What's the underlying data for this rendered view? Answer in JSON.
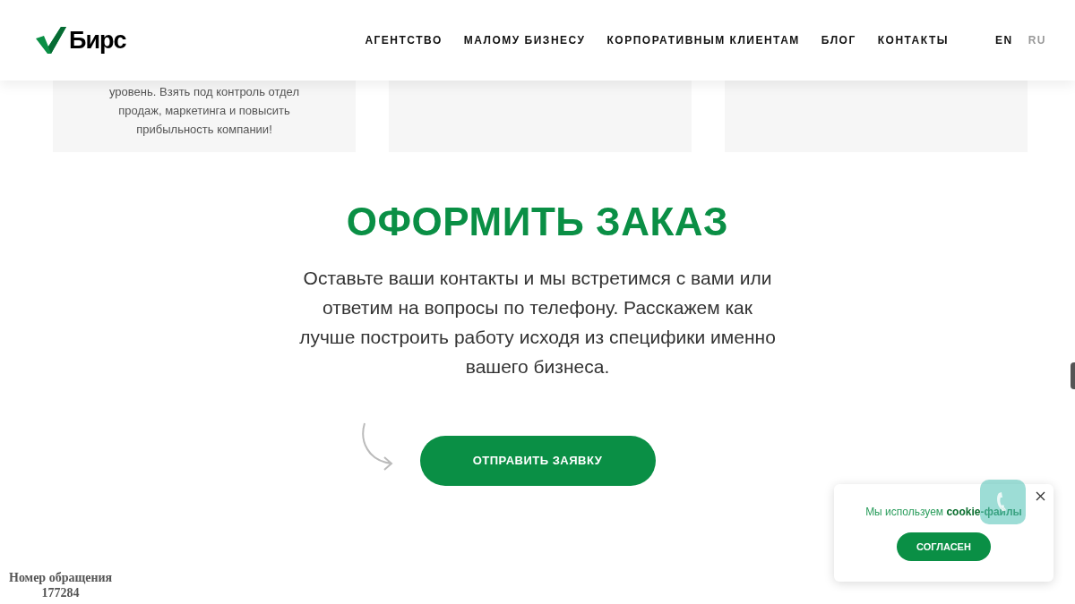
{
  "header": {
    "logo": "Бирс",
    "nav": [
      {
        "label": "АГЕНТСТВО"
      },
      {
        "label": "МАЛОМУ БИЗНЕСУ"
      },
      {
        "label": "КОРПОРАТИВНЫМ КЛИЕНТАМ"
      },
      {
        "label": "БЛОГ"
      },
      {
        "label": "КОНТАКТЫ"
      }
    ],
    "languages": [
      {
        "label": "EN",
        "selected": true
      },
      {
        "label": "RU",
        "selected": false
      }
    ]
  },
  "cards": [
    {
      "kind": "text",
      "text": "уровень. Взять под контроль отдел продаж, маркетинга и повысить прибыльность компании!"
    },
    {
      "kind": "blank"
    },
    {
      "kind": "blank"
    }
  ],
  "order": {
    "title": "ОФОРМИТЬ ЗАКАЗ",
    "text": "Оставьте ваши контакты и мы встретимся с вами или ответим на вопросы по телефону. Расскажем как лучше построить работу исходя из специфики именно вашего бизнеса.",
    "button": "ОТПРАВИТЬ ЗАЯВКУ"
  },
  "cookie": {
    "text": "Мы используем **cookie-файлы**",
    "button": "СОГЛАСЕН"
  },
  "ticket": {
    "label": "Номер обращения",
    "number": "177284"
  }
}
